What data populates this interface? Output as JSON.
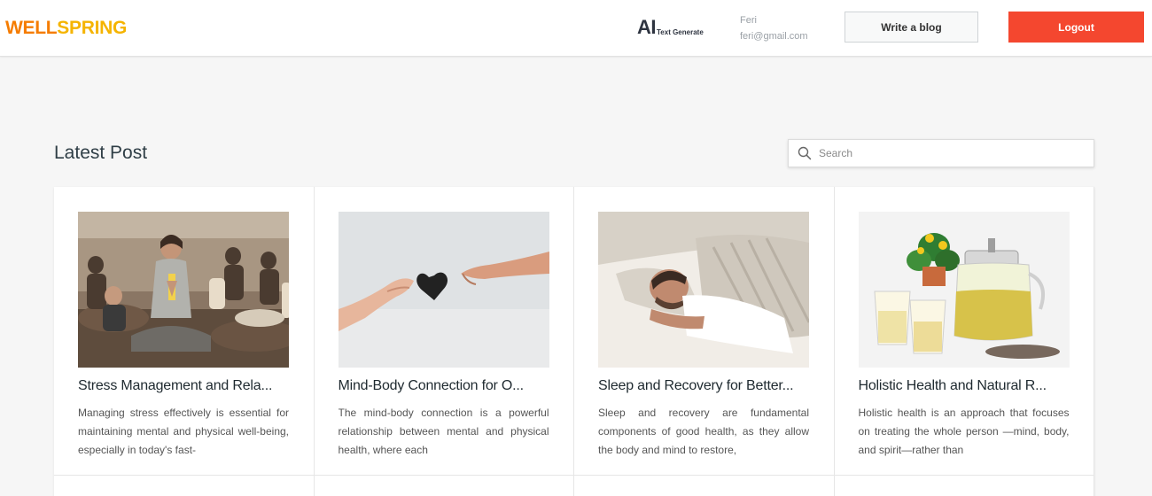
{
  "header": {
    "logo_part1": "WELL",
    "logo_part2": "SPRING",
    "ai_big": "AI",
    "ai_small": "Text Generate",
    "user_name": "Feri",
    "user_email": "feri@gmail.com",
    "write_blog_label": "Write a blog",
    "logout_label": "Logout"
  },
  "main": {
    "section_title": "Latest Post",
    "search_placeholder": "Search"
  },
  "posts": [
    {
      "title": "Stress Management and Rela...",
      "description": "Managing stress effectively is essential for maintaining mental and physical well-being, especially in today's fast-"
    },
    {
      "title": "Mind-Body Connection for O...",
      "description": "The mind-body connection is a powerful relationship between mental and physical health, where each"
    },
    {
      "title": "Sleep and Recovery for Better...",
      "description": "Sleep and recovery are fundamental components of good health, as they allow the body and mind to restore,"
    },
    {
      "title": "Holistic Health and Natural R...",
      "description": "Holistic health is an approach that focuses on treating the whole person —mind, body, and spirit—rather than"
    }
  ],
  "colors": {
    "logo_orange": "#f57c00",
    "logo_yellow": "#f5b400",
    "logout_red": "#f4472f"
  }
}
